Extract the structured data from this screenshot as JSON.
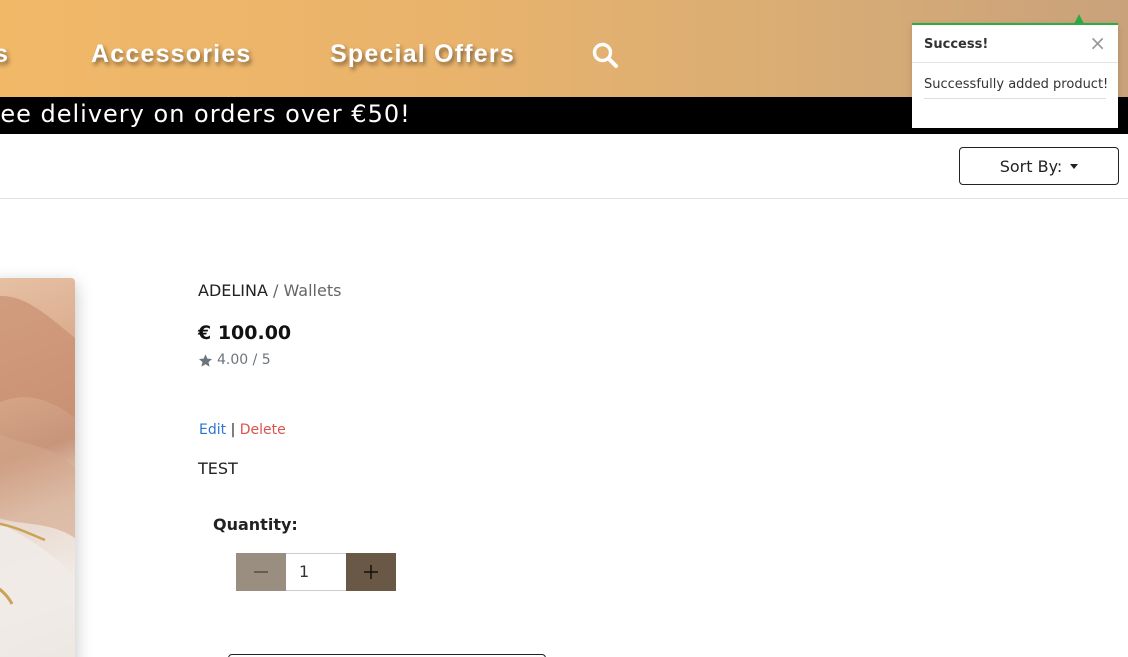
{
  "nav": {
    "items": [
      {
        "label": "s"
      },
      {
        "label": "Accessories"
      },
      {
        "label": "Special Offers"
      }
    ],
    "search_icon": "search-icon"
  },
  "banner": {
    "text": "ree delivery on orders over €50!"
  },
  "toast": {
    "title": "Success!",
    "close": "×",
    "message": "Successfully added product!",
    "accent_color": "#2eaa46"
  },
  "toolbar": {
    "sort_label": "Sort By:"
  },
  "product": {
    "brand": "ADELINA",
    "separator": " / ",
    "category": "Wallets",
    "price": "€ 100.00",
    "rating": "4.00 / 5",
    "edit_label": "Edit",
    "pipe": "|",
    "delete_label": "Delete",
    "description": "TEST",
    "quantity_label": "Quantity:",
    "quantity_value": "1"
  },
  "colors": {
    "nav_gradient_start": "#f1b868",
    "nav_gradient_end": "#c9a27c",
    "edit_link": "#2b76d2",
    "delete_link": "#d9534f",
    "qty_minus_bg": "#9a8e80",
    "qty_plus_bg": "#6a5847"
  }
}
